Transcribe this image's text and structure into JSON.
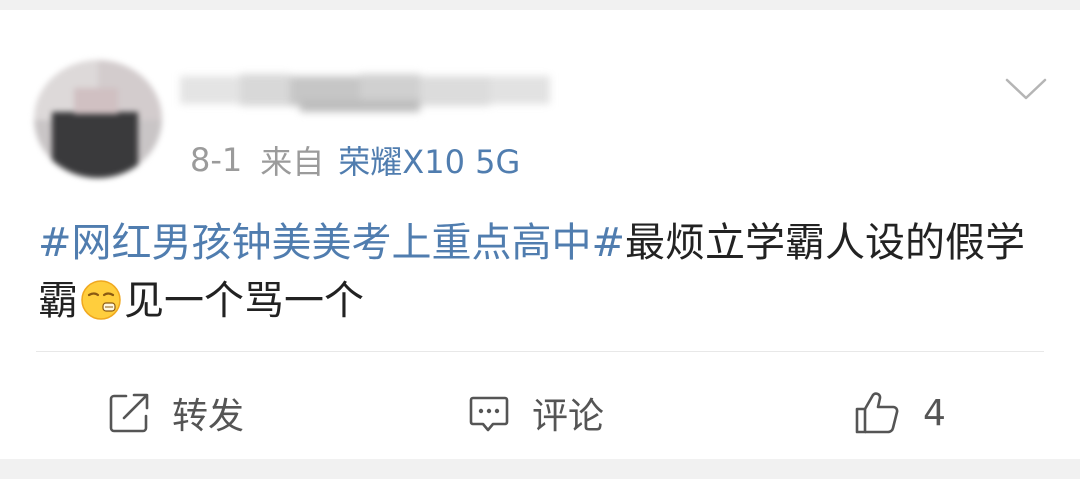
{
  "post": {
    "date": "8-1",
    "source_prefix": "来自",
    "device": "荣耀X10 5G",
    "topic": "#网红男孩钟美美考上重点高中#",
    "text_before_emoji": "最烦立学霸人设的假学霸",
    "emoji": "yawn-face",
    "text_after_emoji": "见一个骂一个"
  },
  "actions": {
    "repost_label": "转发",
    "comment_label": "评论",
    "like_count": "4"
  },
  "icons": [
    "chevron-down-icon",
    "repost-icon",
    "comment-icon",
    "like-icon",
    "yawn-face-emoji"
  ],
  "colors": {
    "link": "#507daf",
    "text": "#222222",
    "meta": "#9b9b9b",
    "background": "#f1f1f1"
  }
}
